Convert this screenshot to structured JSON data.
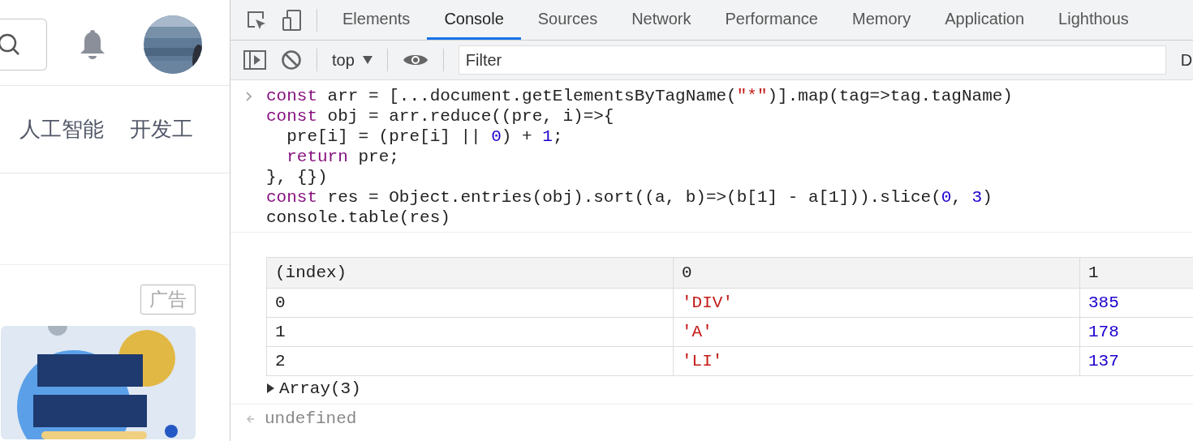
{
  "site": {
    "nav": [
      {
        "label": "人工智能"
      },
      {
        "label": "开发工"
      }
    ],
    "ad_label": "广告"
  },
  "devtools": {
    "tabs": [
      {
        "label": "Elements",
        "selected": false
      },
      {
        "label": "Console",
        "selected": true
      },
      {
        "label": "Sources",
        "selected": false
      },
      {
        "label": "Network",
        "selected": false
      },
      {
        "label": "Performance",
        "selected": false
      },
      {
        "label": "Memory",
        "selected": false
      },
      {
        "label": "Application",
        "selected": false
      },
      {
        "label": "Lighthous",
        "selected": false
      }
    ],
    "toolbar": {
      "context": "top",
      "filter_placeholder": "Filter",
      "levels": "D"
    },
    "console": {
      "input_lines": [
        [
          {
            "kind": "keyword",
            "text": "const"
          },
          {
            "kind": "plain",
            "text": " arr = [...document.getElementsByTagName("
          },
          {
            "kind": "string",
            "text": "\"*\""
          },
          {
            "kind": "plain",
            "text": ")].map(tag=>tag.tagName)"
          }
        ],
        [
          {
            "kind": "keyword",
            "text": "const"
          },
          {
            "kind": "plain",
            "text": " obj = arr.reduce((pre, i)=>{"
          }
        ],
        [
          {
            "kind": "plain",
            "text": "  pre[i] = (pre[i] || "
          },
          {
            "kind": "number",
            "text": "0"
          },
          {
            "kind": "plain",
            "text": ") + "
          },
          {
            "kind": "number",
            "text": "1"
          },
          {
            "kind": "plain",
            "text": ";"
          }
        ],
        [
          {
            "kind": "keyword",
            "text": "  return"
          },
          {
            "kind": "plain",
            "text": " pre;"
          }
        ],
        [
          {
            "kind": "plain",
            "text": "}, {})"
          }
        ],
        [
          {
            "kind": "keyword",
            "text": "const"
          },
          {
            "kind": "plain",
            "text": " res = Object.entries(obj).sort((a, b)=>(b[1] - a[1])).slice("
          },
          {
            "kind": "number",
            "text": "0"
          },
          {
            "kind": "plain",
            "text": ", "
          },
          {
            "kind": "number",
            "text": "3"
          },
          {
            "kind": "plain",
            "text": ")"
          }
        ],
        [
          {
            "kind": "plain",
            "text": "console.table(res)"
          }
        ]
      ],
      "table": {
        "columns": [
          "(index)",
          "0",
          "1"
        ],
        "rows": [
          [
            {
              "kind": "plain",
              "text": "0"
            },
            {
              "kind": "string",
              "text": "'DIV'"
            },
            {
              "kind": "number",
              "text": "385"
            }
          ],
          [
            {
              "kind": "plain",
              "text": "1"
            },
            {
              "kind": "string",
              "text": "'A'"
            },
            {
              "kind": "number",
              "text": "178"
            }
          ],
          [
            {
              "kind": "plain",
              "text": "2"
            },
            {
              "kind": "string",
              "text": "'LI'"
            },
            {
              "kind": "number",
              "text": "137"
            }
          ]
        ]
      },
      "array_summary": {
        "label": "Array(3)",
        "expanded": false
      },
      "result": "undefined"
    }
  }
}
